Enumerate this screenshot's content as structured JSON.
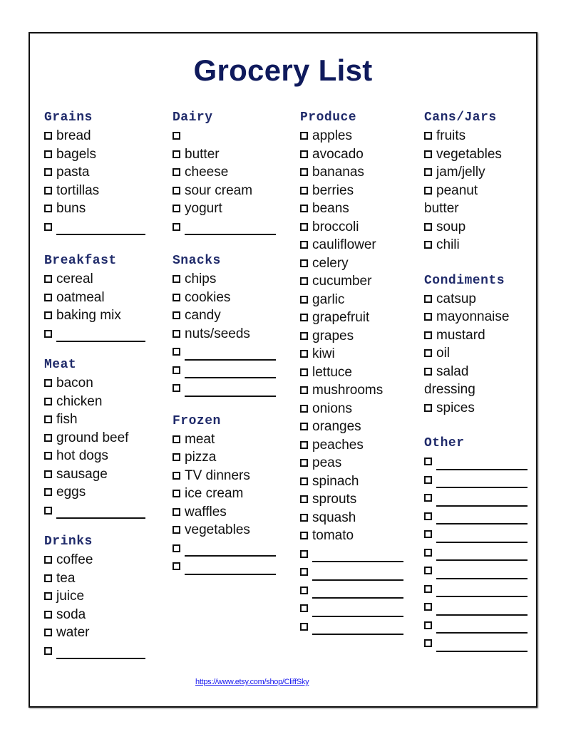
{
  "title": "Grocery List",
  "columns": [
    {
      "sections": [
        {
          "heading": "Grains",
          "items": [
            "bread",
            "bagels",
            "pasta",
            "tortillas",
            "buns"
          ],
          "blanks": 1
        },
        {
          "heading": "Breakfast",
          "items": [
            "cereal",
            "oatmeal",
            "baking mix"
          ],
          "blanks": 1
        },
        {
          "heading": "Meat",
          "items": [
            "bacon",
            "chicken",
            "fish",
            "ground beef",
            "hot dogs",
            "sausage",
            "eggs"
          ],
          "blanks": 1
        },
        {
          "heading": "Drinks",
          "items": [
            "coffee",
            "tea",
            "juice",
            "soda",
            "water"
          ],
          "blanks": 1
        }
      ]
    },
    {
      "sections": [
        {
          "heading": "Dairy",
          "items": [
            "",
            "butter",
            "cheese",
            "sour cream",
            "yogurt"
          ],
          "blanks": 1
        },
        {
          "heading": "Snacks",
          "items": [
            "chips",
            "cookies",
            "candy",
            "nuts/seeds"
          ],
          "blanks": 3
        },
        {
          "heading": "Frozen",
          "items": [
            "meat",
            "pizza",
            "TV dinners",
            "ice cream",
            "waffles",
            "vegetables"
          ],
          "blanks": 2
        }
      ]
    },
    {
      "sections": [
        {
          "heading": "Produce",
          "items": [
            "apples",
            "avocado",
            "bananas",
            "berries",
            "beans",
            "broccoli",
            "cauliflower",
            "celery",
            "cucumber",
            "garlic",
            "grapefruit",
            "grapes",
            "kiwi",
            "lettuce",
            "mushrooms",
            "onions",
            "oranges",
            "peaches",
            "peas",
            "spinach",
            "sprouts",
            "squash",
            "tomato"
          ],
          "blanks": 5
        }
      ]
    },
    {
      "sections": [
        {
          "heading": "Cans/Jars",
          "items": [
            "fruits",
            "vegetables",
            "jam/jelly",
            "peanut",
            "@butter",
            "soup",
            "chili"
          ],
          "blanks": 0
        },
        {
          "heading": "Condiments",
          "items": [
            "catsup",
            "mayonnaise",
            "mustard",
            "oil",
            "salad",
            "@dressing",
            "spices"
          ],
          "blanks": 0
        },
        {
          "heading": "Other",
          "items": [],
          "blanks": 11
        }
      ]
    }
  ],
  "footer_link": "https://www.etsy.com/shop/CliffSky",
  "colors": {
    "title": "#0f1a5c",
    "heading": "#1f2a6a",
    "link": "#1a1aee"
  }
}
